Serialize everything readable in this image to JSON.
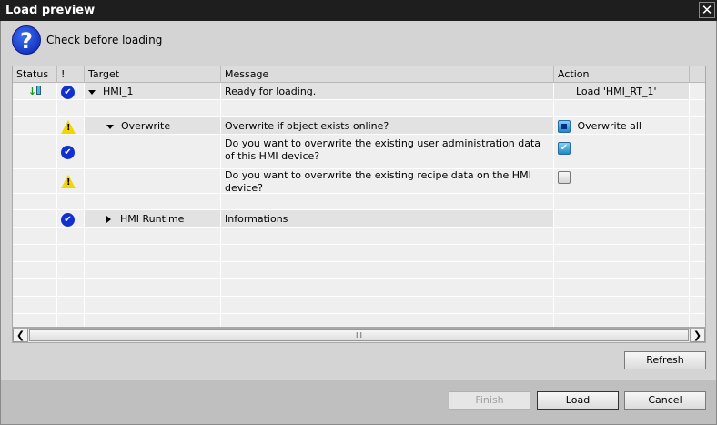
{
  "window": {
    "title": "Load preview",
    "close": "✕"
  },
  "header": {
    "icon": "question-icon",
    "question_mark": "?",
    "subtitle": "Check before loading"
  },
  "table": {
    "columns": [
      "Status",
      "!",
      "Target",
      "Message",
      "Action"
    ],
    "rows": [
      {
        "target": "HMI_1",
        "message": "Ready for loading.",
        "action": "Load 'HMI_RT_1'"
      },
      {
        "target": "Overwrite",
        "message": "Overwrite if object exists online?",
        "action": "Overwrite all"
      },
      {
        "message": "Do you want to overwrite the existing user administration data of this HMI device?",
        "checked": true
      },
      {
        "message": "Do you want to overwrite the existing recipe data on the HMI device?",
        "checked": false
      },
      {
        "target": "HMI Runtime",
        "message": "Informations"
      }
    ]
  },
  "buttons": {
    "refresh": "Refresh",
    "finish": "Finish",
    "load": "Load",
    "cancel": "Cancel"
  },
  "glyphs": {
    "check": "✔",
    "warn": "!",
    "left": "❮",
    "right": "❯",
    "grip": "III"
  }
}
